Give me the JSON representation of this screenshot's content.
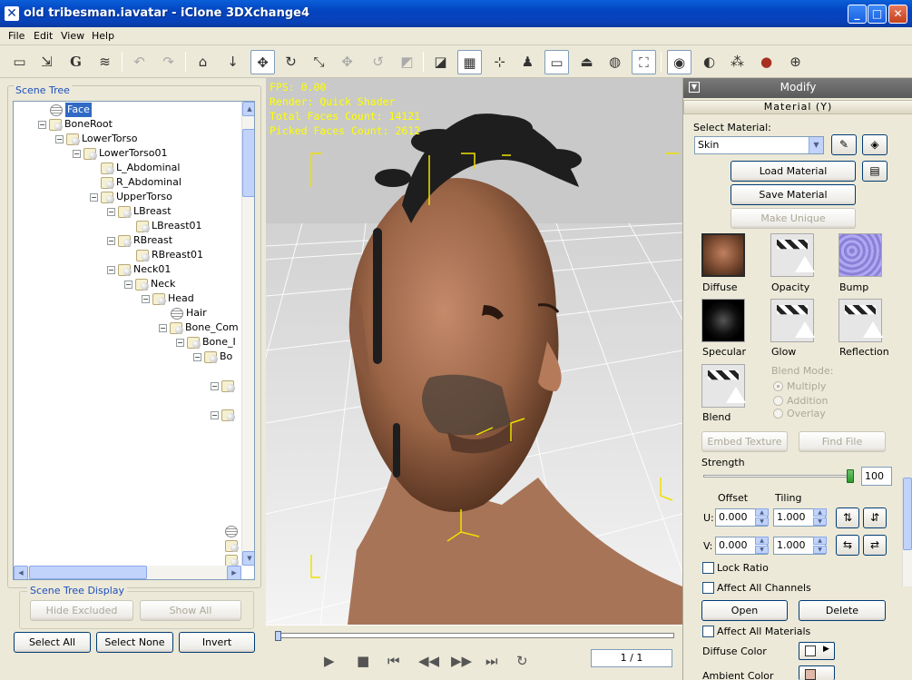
{
  "window": {
    "title": "old tribesman.iavatar - iClone 3DXchange4"
  },
  "menu": [
    "File",
    "Edit",
    "View",
    "Help"
  ],
  "toolbar_icons": [
    "open-icon",
    "export-icon",
    "g-icon",
    "convert-icon",
    "undo-icon",
    "redo-icon",
    "home-icon",
    "move-down-icon",
    "move-icon",
    "rotate-icon",
    "scale-icon",
    "transform-icon",
    "reset-icon",
    "fit-icon",
    "box-icon",
    "grid-icon",
    "axis-icon",
    "figure-icon",
    "view-icon",
    "ground-icon",
    "globe-icon",
    "frame-icon",
    "bulb-icon",
    "toggle-icon",
    "light-icon",
    "color-icon",
    "sphere-icon"
  ],
  "scene_tree": {
    "title": "Scene Tree",
    "nodes": [
      {
        "label": "Face",
        "selected": true
      },
      {
        "label": "BoneRoot"
      },
      {
        "label": "LowerTorso"
      },
      {
        "label": "LowerTorso01"
      },
      {
        "label": "L_Abdominal"
      },
      {
        "label": "R_Abdominal"
      },
      {
        "label": "UpperTorso"
      },
      {
        "label": "LBreast"
      },
      {
        "label": "LBreast01"
      },
      {
        "label": "RBreast"
      },
      {
        "label": "RBreast01"
      },
      {
        "label": "Neck01"
      },
      {
        "label": "Neck"
      },
      {
        "label": "Head"
      },
      {
        "label": "Hair"
      },
      {
        "label": "Bone_Com"
      },
      {
        "label": "Bone_I"
      },
      {
        "label": "Bo"
      }
    ],
    "display_title": "Scene Tree Display",
    "hide_excluded": "Hide Excluded",
    "show_all": "Show All",
    "select_all": "Select All",
    "select_none": "Select None",
    "invert": "Invert"
  },
  "viewport": {
    "fps": "FPS: 0.00",
    "render": "Render: Quick Shader",
    "total_faces": "Total Faces Count: 14121",
    "picked_faces": "Picked Faces Count: 2612"
  },
  "timeline": {
    "frame": "1 / 1"
  },
  "modify": {
    "header": "Modify",
    "section": "Material (Y)",
    "select_material_label": "Select Material:",
    "material_value": "Skin",
    "load_material": "Load Material",
    "save_material": "Save Material",
    "make_unique": "Make Unique",
    "channels": [
      "Diffuse",
      "Opacity",
      "Bump",
      "Specular",
      "Glow",
      "Reflection",
      "Blend"
    ],
    "blend_mode_label": "Blend Mode:",
    "blend_modes": [
      "Multiply",
      "Addition",
      "Overlay"
    ],
    "embed_texture": "Embed Texture",
    "find_file": "Find File",
    "strength_label": "Strength",
    "strength_value": "100",
    "strength": 1.0,
    "offset_label": "Offset",
    "tiling_label": "Tiling",
    "u_label": "U:",
    "v_label": "V:",
    "u_offset": "0.000",
    "u_tiling": "1.000",
    "v_offset": "0.000",
    "v_tiling": "1.000",
    "lock_ratio": "Lock Ratio",
    "affect_all_channels": "Affect All Channels",
    "open": "Open",
    "delete": "Delete",
    "affect_all_materials": "Affect All Materials",
    "diffuse_color": "Diffuse Color",
    "ambient_color": "Ambient Color"
  }
}
